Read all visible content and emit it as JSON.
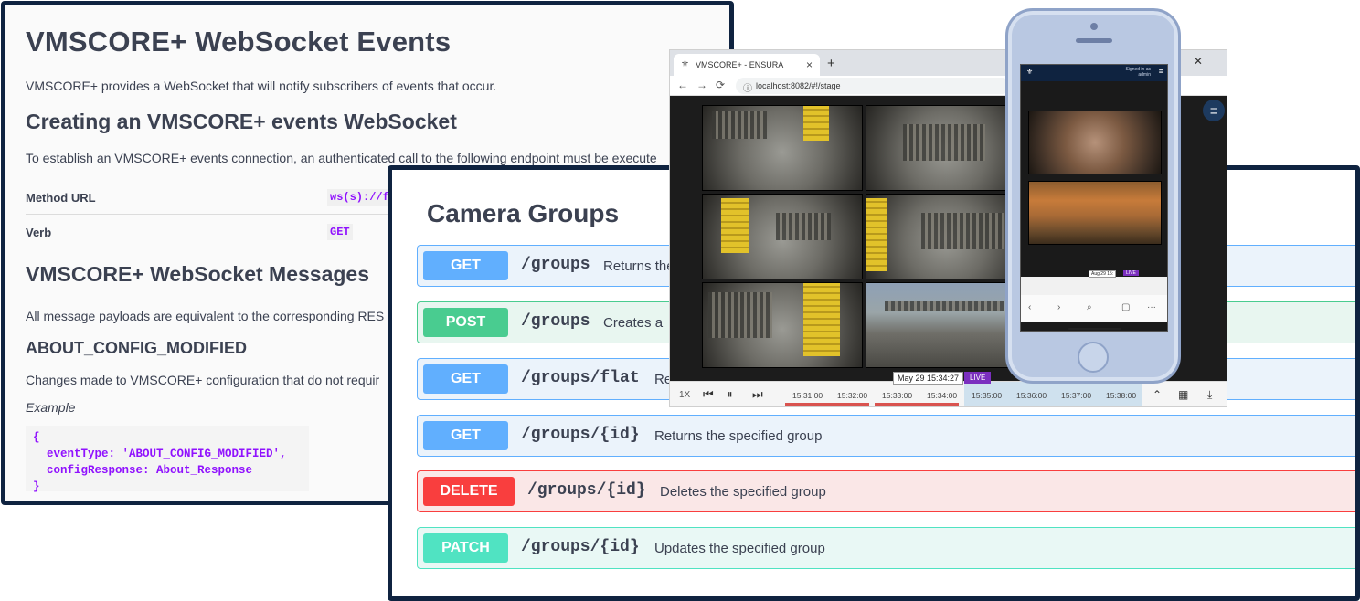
{
  "doc": {
    "title": "VMSCORE+ WebSocket Events",
    "intro": "VMSCORE+ provides a WebSocket that will notify subscribers of events that occur.",
    "section1_title": "Creating an VMSCORE+ events WebSocket",
    "section1_text": "To establish an VMSCORE+ events connection, an authenticated call to the following endpoint must be execute",
    "table": [
      {
        "key": "Method URL",
        "value": "ws(s)://f"
      },
      {
        "key": "Verb",
        "value": "GET"
      }
    ],
    "section2_title": "VMSCORE+ WebSocket Messages",
    "section2_text": "All message payloads are equivalent to the corresponding RES",
    "event_title": "ABOUT_CONFIG_MODIFIED",
    "event_text": "Changes made to VMSCORE+ configuration that do not requir",
    "example_label": "Example",
    "code": "{\n  eventType: 'ABOUT_CONFIG_MODIFIED',\n  configResponse: About_Response\n}"
  },
  "api": {
    "title": "Camera Groups",
    "operations": [
      {
        "method": "GET",
        "path": "/groups",
        "desc": "Returns the"
      },
      {
        "method": "POST",
        "path": "/groups",
        "desc": "Creates a"
      },
      {
        "method": "GET",
        "path": "/groups/flat",
        "desc": "Re"
      },
      {
        "method": "GET",
        "path": "/groups/{id}",
        "desc": "Returns the specified group"
      },
      {
        "method": "DELETE",
        "path": "/groups/{id}",
        "desc": "Deletes the specified group"
      },
      {
        "method": "PATCH",
        "path": "/groups/{id}",
        "desc": "Updates the specified group"
      }
    ]
  },
  "browser": {
    "tab_title": "VMSCORE+ - ENSURA",
    "url": "localhost:8082/#!/stage",
    "new_tab": "+",
    "close_tab": "×",
    "window_controls": "– □ ✕",
    "nav_back": "←",
    "nav_forward": "→",
    "nav_reload": "⟳",
    "menu_icon": "≡",
    "timeline": {
      "speed": "1X",
      "ticks": [
        "15:31:00",
        "15:32:00",
        "15:33:00",
        "15:34:00",
        "15:35:00",
        "15:36:00",
        "15:37:00",
        "15:38:00"
      ],
      "cursor_label": "May 29 15:34:27",
      "live_label": "LIVE",
      "prev": "⏮",
      "pause": "⏸",
      "next": "⏭",
      "collapse": "⌃",
      "calendar": "▦",
      "download": "⤓"
    }
  },
  "phone": {
    "signed_in_as": "Signed in as",
    "user": "admin",
    "menu": "≡",
    "tl_label": "Aug 29 15:",
    "tl_live": "LIVE",
    "nav": [
      "‹",
      "›",
      "⌕",
      "▢",
      "···"
    ]
  }
}
